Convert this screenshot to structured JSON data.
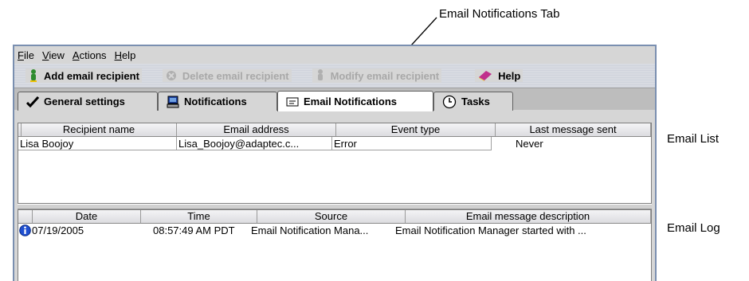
{
  "callouts": {
    "tab": "Email Notifications Tab",
    "list": "Email List",
    "log": "Email Log"
  },
  "menu": [
    {
      "label": "File",
      "mnemonic": "F"
    },
    {
      "label": "View",
      "mnemonic": "V"
    },
    {
      "label": "Actions",
      "mnemonic": "A"
    },
    {
      "label": "Help",
      "mnemonic": "H"
    }
  ],
  "toolbar": {
    "add": "Add email recipient",
    "delete": "Delete email recipient",
    "modify": "Modify email recipient",
    "help": "Help"
  },
  "tabs": {
    "general": "General settings",
    "notifications": "Notifications",
    "email": "Email Notifications",
    "tasks": "Tasks"
  },
  "email_list": {
    "columns": [
      "Recipient name",
      "Email address",
      "Event type",
      "Last message sent"
    ],
    "rows": [
      [
        "Lisa Boojoy",
        "Lisa_Boojoy@adaptec.c...",
        "Error",
        "Never"
      ]
    ]
  },
  "email_log": {
    "columns": [
      "Date",
      "Time",
      "Source",
      "Email message description"
    ],
    "rows": [
      {
        "date": "07/19/2005",
        "time": "08:57:49 AM PDT",
        "source": "Email Notification Mana...",
        "description": "Email Notification Manager started with ..."
      }
    ]
  },
  "colors": {
    "window_border": "#7a8fb0",
    "info_icon": "#1f4fd1"
  }
}
